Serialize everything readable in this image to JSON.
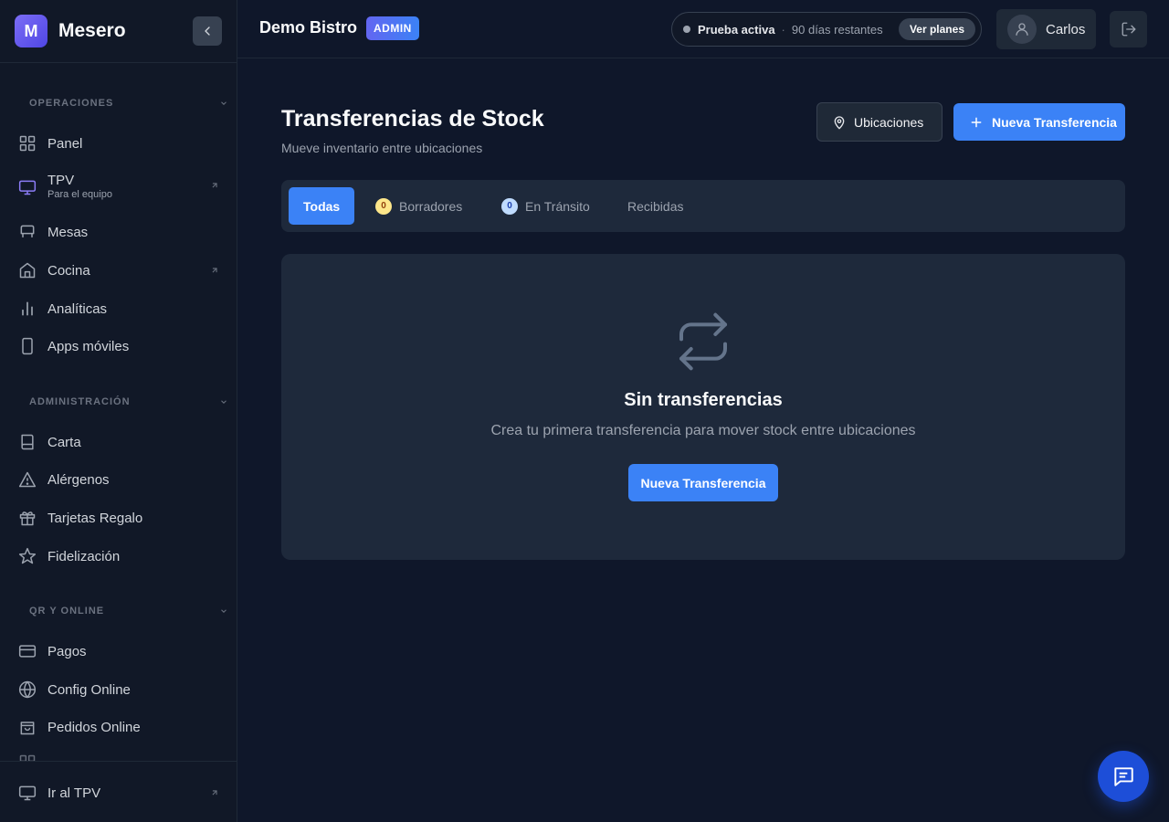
{
  "brand": {
    "logo_letter": "M",
    "name": "Mesero"
  },
  "sidebar": {
    "sections": [
      {
        "title": "OPERACIONES"
      },
      {
        "title": "ADMINISTRACIÓN"
      },
      {
        "title": "QR Y ONLINE"
      }
    ],
    "items": [
      {
        "label": "Panel",
        "icon": "grid-icon"
      },
      {
        "label": "TPV",
        "sub": "Para el equipo",
        "icon": "monitor-icon",
        "external": true
      },
      {
        "label": "Mesas",
        "icon": "chair-icon"
      },
      {
        "label": "Cocina",
        "icon": "home-icon",
        "external": true
      },
      {
        "label": "Analíticas",
        "icon": "bar-chart-icon"
      },
      {
        "label": "Apps móviles",
        "icon": "smartphone-icon"
      },
      {
        "label": "Carta",
        "icon": "book-icon"
      },
      {
        "label": "Alérgenos",
        "icon": "warning-icon"
      },
      {
        "label": "Tarjetas Regalo",
        "icon": "gift-icon"
      },
      {
        "label": "Fidelización",
        "icon": "star-icon"
      },
      {
        "label": "Pagos",
        "icon": "credit-card-icon"
      },
      {
        "label": "Config Online",
        "icon": "globe-icon"
      },
      {
        "label": "Pedidos Online",
        "icon": "shopping-bag-icon"
      }
    ],
    "footer": {
      "label": "Ir al TPV",
      "icon": "monitor-icon"
    }
  },
  "topbar": {
    "business": "Demo Bistro",
    "role_badge": "ADMIN",
    "trial": {
      "status": "Prueba activa",
      "separator": "·",
      "remaining": "90 días restantes",
      "plans_label": "Ver planes"
    },
    "user": "Carlos"
  },
  "page": {
    "title": "Transferencias de Stock",
    "subtitle": "Mueve inventario entre ubicaciones",
    "locations_button": "Ubicaciones",
    "new_button": "Nueva Transferencia"
  },
  "tabs": [
    {
      "label": "Todas",
      "active": true
    },
    {
      "label": "Borradores",
      "count": "0",
      "count_color": "#fde68a"
    },
    {
      "label": "En Tránsito",
      "count": "0",
      "count_color": "#bfdbfe"
    },
    {
      "label": "Recibidas"
    }
  ],
  "empty_state": {
    "title": "Sin transferencias",
    "description": "Crea tu primera transferencia para mover stock entre ubicaciones",
    "button": "Nueva Transferencia"
  },
  "colors": {
    "primary": "#3b82f6",
    "background": "#0f172a",
    "card": "#1e293b",
    "sidebar": "#111827"
  }
}
